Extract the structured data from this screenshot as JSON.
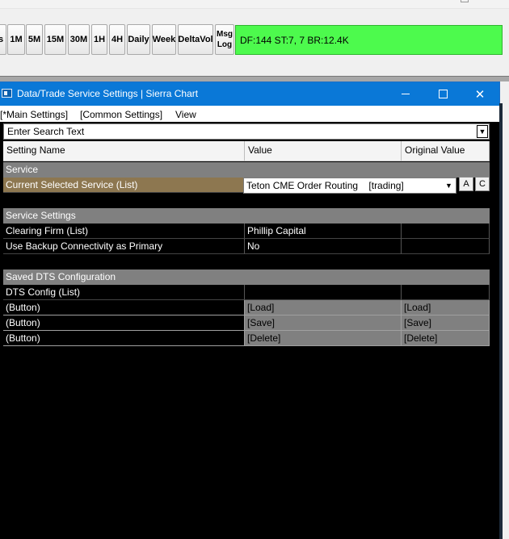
{
  "toolbar": {
    "buttons": [
      {
        "label": "s",
        "left": 0
      },
      {
        "label": "1M"
      },
      {
        "label": "5M"
      },
      {
        "label": "15M"
      },
      {
        "label": "30M"
      },
      {
        "label": "1H"
      },
      {
        "label": "4H"
      },
      {
        "label": "Daily"
      },
      {
        "label": "Week"
      },
      {
        "label": "DeltaVol"
      }
    ],
    "msg_log_line1": "Msg",
    "msg_log_line2": "Log",
    "status_text": "DF:144  ST:7, 7  BR:12.4K",
    "status_color": "#4dfa4d"
  },
  "window": {
    "title": "Data/Trade Service Settings | Sierra Chart",
    "app_icon": "app-window-icon",
    "minimize_icon": "minimize-icon",
    "maximize_icon": "maximize-icon",
    "close_glyph": "✕",
    "title_color": "#0a78d7"
  },
  "menu": {
    "items": [
      "[*Main Settings]",
      "[Common Settings]",
      "View"
    ]
  },
  "search": {
    "placeholder": "Enter Search Text",
    "value": ""
  },
  "grid": {
    "headers": [
      "Setting Name",
      "Value",
      "Original Value"
    ],
    "section_service": "Service",
    "selected_service_name": "Current Selected Service (List)",
    "selected_service_value": "Teton CME Order Routing    [trading]",
    "btn_a": "A",
    "btn_c": "C",
    "section_service_settings": "Service Settings",
    "clearing_firm_name": "Clearing Firm (List)",
    "clearing_firm_value": "Phillip Capital",
    "clearing_firm_original": "",
    "backup_name": "Use Backup Connectivity as Primary",
    "backup_value": "No",
    "backup_original": "",
    "section_saved": "Saved DTS Configuration",
    "dts_config_name": "DTS Config (List)",
    "button_rows": [
      {
        "name": " (Button)",
        "value": "[Load]",
        "original": "[Load]"
      },
      {
        "name": " (Button)",
        "value": "[Save]",
        "original": "[Save]"
      },
      {
        "name": " (Button)",
        "value": "[Delete]",
        "original": "[Delete]"
      }
    ]
  },
  "colors": {
    "selected_row": "#8d7750",
    "section_header": "#808080",
    "grid_background": "#000000"
  }
}
